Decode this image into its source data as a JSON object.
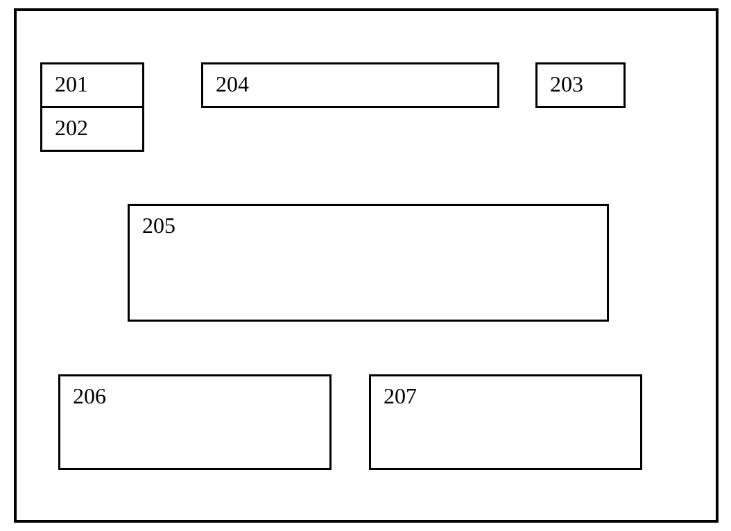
{
  "boxes": {
    "b201": "201",
    "b202": "202",
    "b203": "203",
    "b204": "204",
    "b205": "205",
    "b206": "206",
    "b207": "207"
  }
}
